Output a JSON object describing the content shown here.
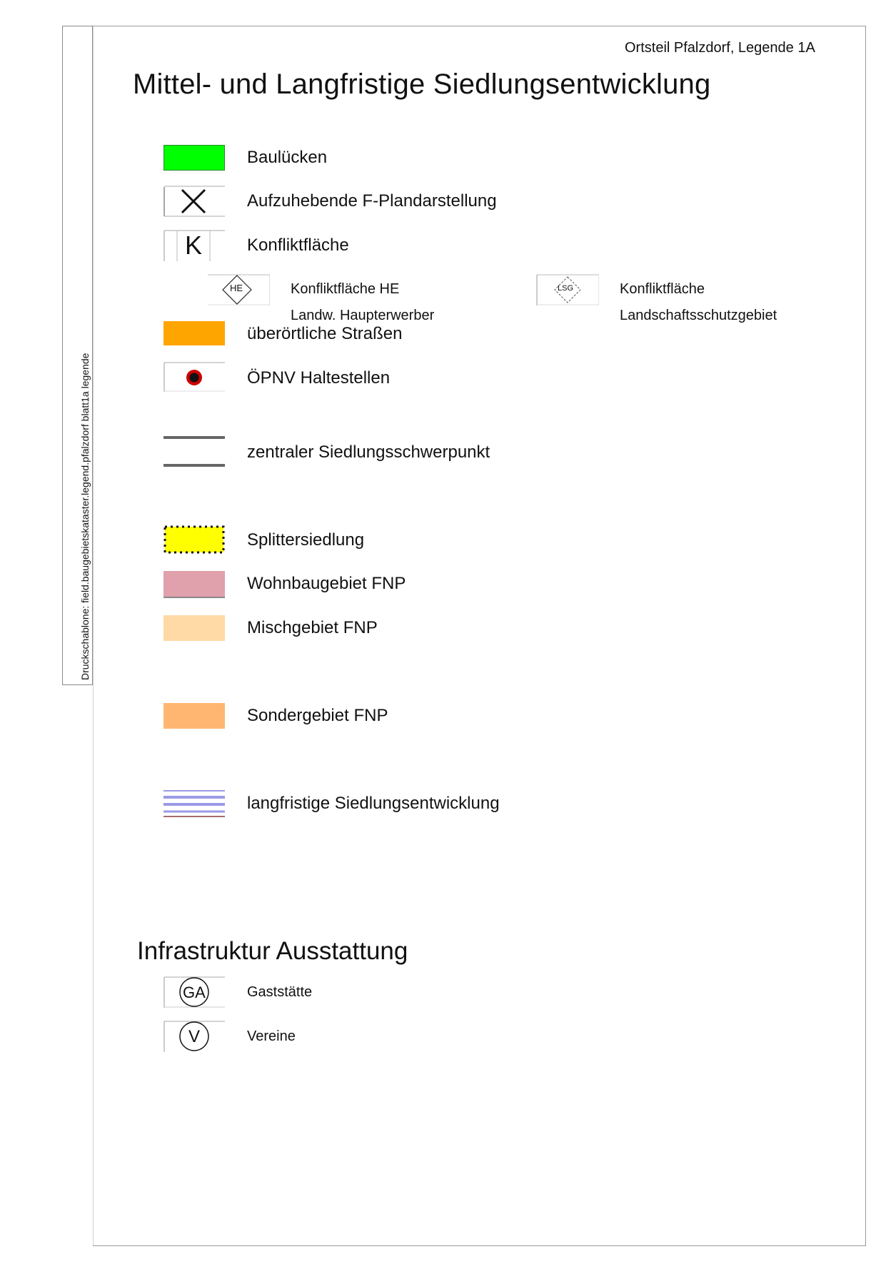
{
  "sidebar": {
    "template_text": "Druckschablone: field.baugebietskataster.legend.pfalzdorf blatt1a legende"
  },
  "header": {
    "sheet_label": "Ortsteil Pfalzdorf, Legende 1A"
  },
  "section1": {
    "title": "Mittel- und Langfristige Siedlungsentwicklung",
    "items": [
      {
        "label": "Baulücken",
        "color": "#00ff00"
      },
      {
        "label": "Aufzuhebende F-Plandarstellung"
      },
      {
        "label": "Konfliktfläche",
        "symbol_text": "K"
      },
      {
        "label": "überörtliche Straßen",
        "color": "#ffa500"
      },
      {
        "label": "ÖPNV Haltestellen",
        "color": "#cc0000"
      },
      {
        "label": "zentraler Siedlungsschwerpunkt",
        "color": "#666666"
      },
      {
        "label": "Splittersiedlung",
        "color": "#ffff00"
      },
      {
        "label": "Wohnbaugebiet FNP",
        "color": "#e0a0ac"
      },
      {
        "label": "Mischgebiet FNP",
        "color": "#ffdaa6"
      },
      {
        "label": "Sondergebiet FNP",
        "color": "#ffb671"
      },
      {
        "label": "langfristige Siedlungsentwicklung",
        "color": "#9a9ae6"
      }
    ],
    "sub_items": [
      {
        "label": "Konfliktfläche HE",
        "label2": "Landw. Haupterwerber",
        "symbol_text": "HE"
      },
      {
        "label": "Konfliktfläche",
        "label2": "Landschaftsschutzgebiet",
        "symbol_text": "LSG"
      }
    ]
  },
  "section2": {
    "title": "Infrastruktur Ausstattung",
    "items": [
      {
        "label": "Gaststätte",
        "symbol_text": "GA"
      },
      {
        "label": "Vereine",
        "symbol_text": "V"
      }
    ]
  }
}
